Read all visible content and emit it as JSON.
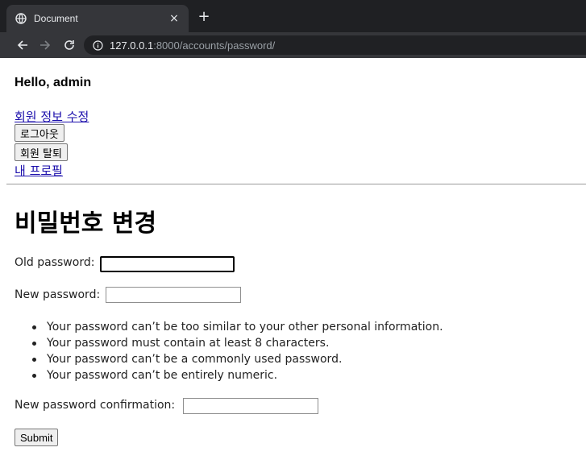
{
  "browser": {
    "tab_title": "Document",
    "tab_close": "×",
    "new_tab": "+",
    "url_host": "127.0.0.1",
    "url_rest": ":8000/accounts/password/"
  },
  "header": {
    "greeting": "Hello, admin",
    "edit_profile_link": "회원 정보 수정",
    "logout_button": "로그아웃",
    "delete_account_button": "회원 탈퇴",
    "my_profile_link": "내 프로필"
  },
  "main": {
    "title": "비밀번호 변경",
    "old_password_label": "Old password:",
    "new_password_label": "New password:",
    "help_text": [
      "Your password can’t be too similar to your other personal information.",
      "Your password must contain at least 8 characters.",
      "Your password can’t be a commonly used password.",
      "Your password can’t be entirely numeric."
    ],
    "confirm_label": "New password confirmation:",
    "submit_label": "Submit",
    "old_password_value": "",
    "new_password_value": "",
    "confirm_value": ""
  },
  "colors": {
    "link": "#1a0dab",
    "chrome_dark": "#1f2023",
    "chrome_tab": "#35363a"
  },
  "icons": [
    "globe-icon",
    "close-icon",
    "plus-icon",
    "back-arrow-icon",
    "forward-arrow-icon",
    "reload-icon",
    "info-icon"
  ]
}
